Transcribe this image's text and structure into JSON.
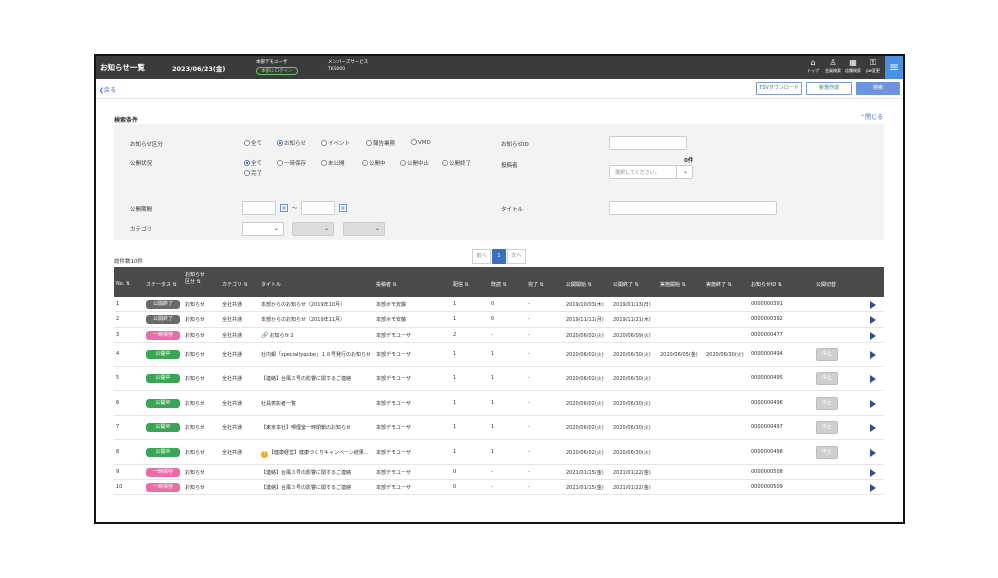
{
  "header": {
    "title": "お知らせ一覧",
    "date": "2023/06/23(金)",
    "org": "本部デモユーザ",
    "switch_label": "本部にログイン",
    "service": "メンバーズサービス",
    "user": "TKS000",
    "icons": [
      {
        "name": "home-icon",
        "glyph": "⌂",
        "label": "トップ"
      },
      {
        "name": "member-search-icon",
        "glyph": "♙",
        "label": "会員検索"
      },
      {
        "name": "store-search-icon",
        "glyph": "▦",
        "label": "店舗検索"
      },
      {
        "name": "pw-change-icon",
        "glyph": "⚿",
        "label": "pw変更"
      }
    ],
    "menu_icon": "≡"
  },
  "actions": {
    "back": "❮戻る",
    "tsv_download": "TSVダウンロード",
    "new": "新規作成",
    "search": "検索"
  },
  "search": {
    "heading": "検索条件",
    "close": "⌃閉じる",
    "category_label": "お知らせ区分",
    "category_options": [
      "全て",
      "お知らせ",
      "イベント",
      "報告業務",
      "VMD"
    ],
    "status_label": "公開状況",
    "status_options": [
      "全て",
      "一時保存",
      "未公開",
      "公開中",
      "公開中止",
      "公開終了",
      "完了"
    ],
    "id_label": "お知らせID",
    "poster_label": "投稿者",
    "poster_count": "0件",
    "poster_placeholder": "選択してください。",
    "period_label": "公開期間",
    "period_sep": "〜",
    "title_label": "タイトル",
    "cat_label": "カテゴリ"
  },
  "list": {
    "total": "総件数10件",
    "pager": {
      "prev": "前へ",
      "page": "1",
      "next": "次へ"
    },
    "columns": [
      "No.",
      "ステータス",
      "お知らせ区分",
      "カテゴリ",
      "タイトル",
      "投稿者",
      "配信",
      "既読",
      "完了",
      "公開開始",
      "公開終了",
      "実施開始",
      "実施終了",
      "お知らせID",
      "公開切替"
    ],
    "stop_label": "中止",
    "rows": [
      {
        "no": "1",
        "status": "公開終了",
        "type": "お知らせ",
        "category": "全社共通",
        "title": "本部からのお知らせ（2019年10月）",
        "poster": "本部ボモ安藤",
        "delivered": "1",
        "read": "0",
        "done": "-",
        "start": "2019/10/03(木)",
        "end": "2019/01/13(日)",
        "exec_start": "",
        "exec_end": "",
        "id": "0000000391"
      },
      {
        "no": "2",
        "status": "公開終了",
        "type": "お知らせ",
        "category": "全社共通",
        "title": "本部からのお知らせ（2019年11月）",
        "poster": "本部ボモ安藤",
        "delivered": "1",
        "read": "0",
        "done": "-",
        "start": "2019/11/11(月)",
        "end": "2019/11/21(木)",
        "exec_start": "",
        "exec_end": "",
        "id": "0000000392"
      },
      {
        "no": "3",
        "status": "一時保存",
        "type": "お知らせ",
        "category": "全社共通",
        "title": "お知らせ２",
        "poster": "本部デモユーザ",
        "delivered": "2",
        "read": "-",
        "done": "-",
        "start": "2020/06/02(火)",
        "end": "2020/06/09(火)",
        "exec_start": "",
        "exec_end": "",
        "id": "0000000477"
      },
      {
        "no": "4",
        "status": "公開中",
        "type": "お知らせ",
        "category": "全社共通",
        "title": "社内報「specialtyqube」１８号発行のお知らせ",
        "poster": "本部デモユーザ",
        "delivered": "1",
        "read": "1",
        "done": "-",
        "start": "2020/06/02(火)",
        "end": "2020/06/30(火)",
        "exec_start": "2020/06/05(金)",
        "exec_end": "2020/06/30(火)",
        "id": "0000000494"
      },
      {
        "no": "5",
        "status": "公開中",
        "type": "お知らせ",
        "category": "全社共通",
        "title": "【連絡】台風３号の影響に関するご連絡",
        "poster": "本部デモユーザ",
        "delivered": "1",
        "read": "1",
        "done": "-",
        "start": "2020/06/02(火)",
        "end": "2020/06/30(火)",
        "exec_start": "",
        "exec_end": "",
        "id": "0000000495"
      },
      {
        "no": "6",
        "status": "公開中",
        "type": "お知らせ",
        "category": "全社共通",
        "title": "社員表彰者一覧",
        "poster": "本部デモユーザ",
        "delivered": "1",
        "read": "1",
        "done": "-",
        "start": "2020/06/02(火)",
        "end": "2020/06/30(火)",
        "exec_start": "",
        "exec_end": "",
        "id": "0000000496"
      },
      {
        "no": "7",
        "status": "公開中",
        "type": "お知らせ",
        "category": "全社共通",
        "title": "【東京本社】喫煙室一時閉鎖のお知らせ",
        "poster": "本部デモユーザ",
        "delivered": "1",
        "read": "1",
        "done": "-",
        "start": "2020/06/02(火)",
        "end": "2020/06/30(火)",
        "exec_start": "",
        "exec_end": "",
        "id": "0000000497"
      },
      {
        "no": "8",
        "status": "公開中",
        "type": "お知らせ",
        "category": "全社共通",
        "title": "【健康経営】健康づくりキャンペーン結果…",
        "poster": "本部デモユーザ",
        "delivered": "1",
        "read": "1",
        "done": "-",
        "start": "2020/06/02(火)",
        "end": "2020/06/30(火)",
        "exec_start": "",
        "exec_end": "",
        "id": "0000000498"
      },
      {
        "no": "9",
        "status": "一時保存",
        "type": "お知らせ",
        "category": "",
        "title": "【連絡】台風３号の影響に関するご連絡",
        "poster": "本部デモユーザ",
        "delivered": "0",
        "read": "-",
        "done": "-",
        "start": "2021/01/15(金)",
        "end": "2021/01/22(金)",
        "exec_start": "",
        "exec_end": "",
        "id": "0000000508"
      },
      {
        "no": "10",
        "status": "一時保存",
        "type": "お知らせ",
        "category": "",
        "title": "【連絡】台風３号の影響に関するご連絡",
        "poster": "本部デモユーザ",
        "delivered": "0",
        "read": "-",
        "done": "-",
        "start": "2021/01/15(金)",
        "end": "2021/01/22(金)",
        "exec_start": "",
        "exec_end": "",
        "id": "0000000509"
      }
    ]
  },
  "colors": {
    "header_bg": "#3b3b3b",
    "accent": "#4a90e2",
    "status_ended": "#6a6a6a",
    "status_active": "#3aa655",
    "status_draft": "#e56fa6"
  }
}
